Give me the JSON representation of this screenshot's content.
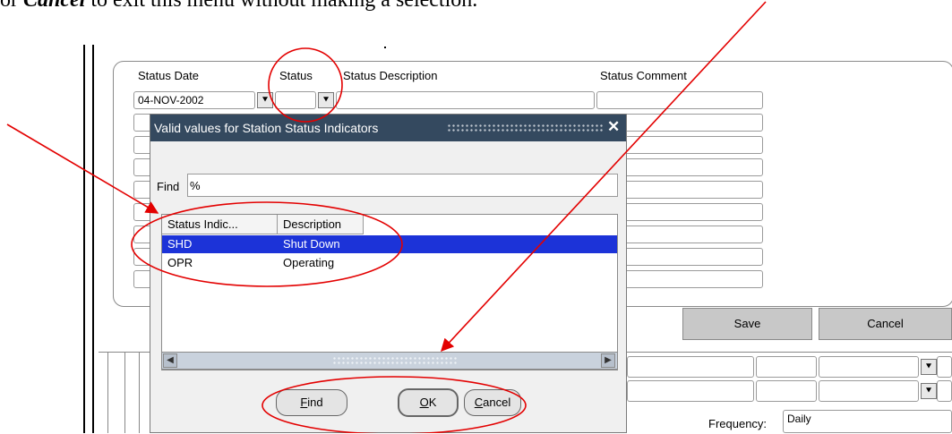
{
  "instruction": {
    "prefix": "or ",
    "emphasis": "Cancel",
    "suffix": " to exit this menu without making a selection."
  },
  "form": {
    "headers": {
      "status_date": "Status Date",
      "status": "Status",
      "status_description": "Status Description",
      "status_comment": "Status Comment"
    },
    "first_row": {
      "status_date": "04-NOV-2002",
      "status": "",
      "status_description": "",
      "status_comment": ""
    },
    "buttons": {
      "save": "Save",
      "cancel": "Cancel"
    },
    "frequency_label": "Frequency:",
    "frequency_value": "Daily"
  },
  "dialog": {
    "title": "Valid values for Station Status Indicators",
    "close_glyph": "✕",
    "find_label": "Find",
    "find_value": "%",
    "columns": [
      "Status Indic...",
      "Description"
    ],
    "rows": [
      {
        "code": "SHD",
        "description": "Shut Down",
        "selected": true
      },
      {
        "code": "OPR",
        "description": "Operating",
        "selected": false
      }
    ],
    "buttons": {
      "find": {
        "mnemonic": "F",
        "rest": "ind"
      },
      "ok": {
        "mnemonic": "O",
        "rest": "K"
      },
      "cancel": {
        "mnemonic": "C",
        "rest": "ancel"
      }
    }
  },
  "icons": {
    "dropdown": "⯆",
    "scroll_left": "◀",
    "scroll_right": "▶"
  },
  "colors": {
    "selection": "#1c33d8",
    "titlebar": "#34495f",
    "annotation": "#e30000"
  }
}
